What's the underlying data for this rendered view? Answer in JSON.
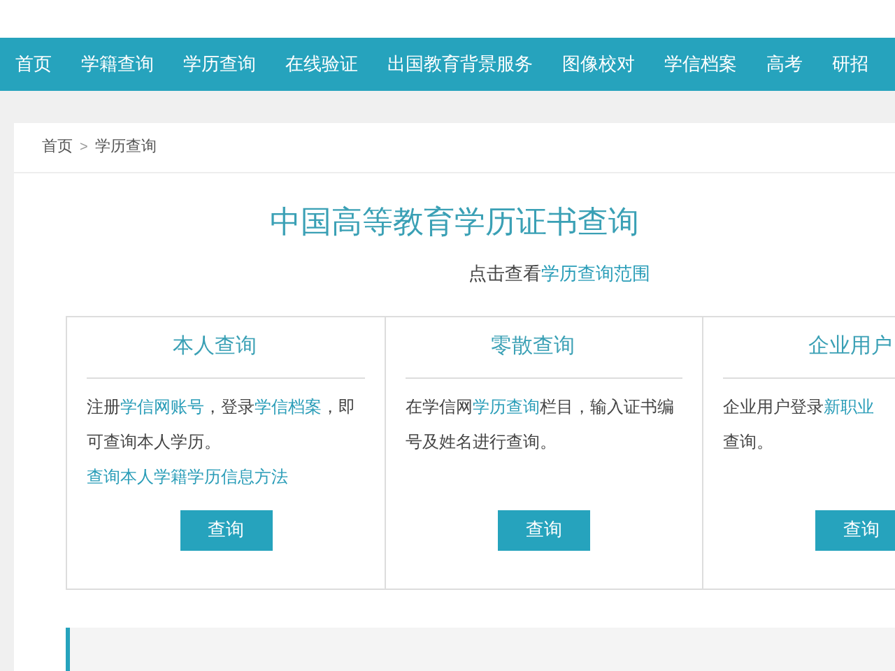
{
  "nav": [
    {
      "label": "首页"
    },
    {
      "label": "学籍查询"
    },
    {
      "label": "学历查询"
    },
    {
      "label": "在线验证"
    },
    {
      "label": "出国教育背景服务"
    },
    {
      "label": "图像校对"
    },
    {
      "label": "学信档案"
    },
    {
      "label": "高考"
    },
    {
      "label": "研招"
    }
  ],
  "breadcrumb": {
    "items": [
      "首页",
      "学历查询"
    ],
    "separator": ">"
  },
  "title": "中国高等教育学历证书查询",
  "subtitle": [
    {
      "text": "点击查看",
      "link": false
    },
    {
      "text": "学历查询范围",
      "link": true
    }
  ],
  "cards": [
    {
      "title": "本人查询",
      "paragraphs": [
        [
          {
            "text": "注册",
            "link": false
          },
          {
            "text": "学信网账号",
            "link": true
          },
          {
            "text": "，登录",
            "link": false
          },
          {
            "text": "学信档案",
            "link": true
          },
          {
            "text": "，即可查询本人学历。",
            "link": false
          }
        ],
        [
          {
            "text": "查询本人学籍学历信息方法",
            "link": true
          }
        ]
      ],
      "button": "查询"
    },
    {
      "title": "零散查询",
      "paragraphs": [
        [
          {
            "text": "在学信网",
            "link": false
          },
          {
            "text": "学历查询",
            "link": true
          },
          {
            "text": "栏目，输入证书编号及姓名进行查询。",
            "link": false
          }
        ]
      ],
      "button": "查询"
    },
    {
      "title": "企业用户",
      "paragraphs": [
        [
          {
            "text": "企业用户登录",
            "link": false
          },
          {
            "text": "新职业",
            "link": true
          }
        ],
        [
          {
            "text": "查询。",
            "link": false
          }
        ]
      ],
      "button": "查询"
    }
  ]
}
